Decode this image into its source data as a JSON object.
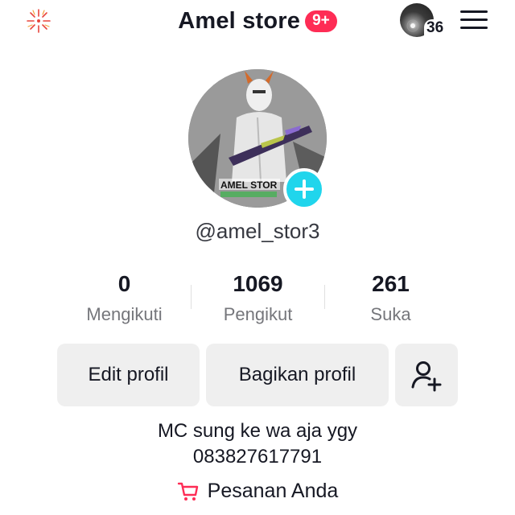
{
  "header": {
    "title": "Amel store",
    "notification_badge": "9+",
    "avatar_count": "36",
    "accent_color": "#fe2c55"
  },
  "profile": {
    "username": "@amel_stor3",
    "avatar_watermark": "AMEL STOR",
    "add_color": "#20d5ec"
  },
  "stats": [
    {
      "value": "0",
      "label": "Mengikuti"
    },
    {
      "value": "1069",
      "label": "Pengikut"
    },
    {
      "value": "261",
      "label": "Suka"
    }
  ],
  "actions": {
    "edit_label": "Edit profil",
    "share_label": "Bagikan profil",
    "add_friend_icon": "add-user-icon"
  },
  "bio": {
    "line1": "MC sung ke wa aja ygy",
    "line2": "083827617791"
  },
  "orders": {
    "label": "Pesanan Anda",
    "icon": "cart-icon"
  }
}
